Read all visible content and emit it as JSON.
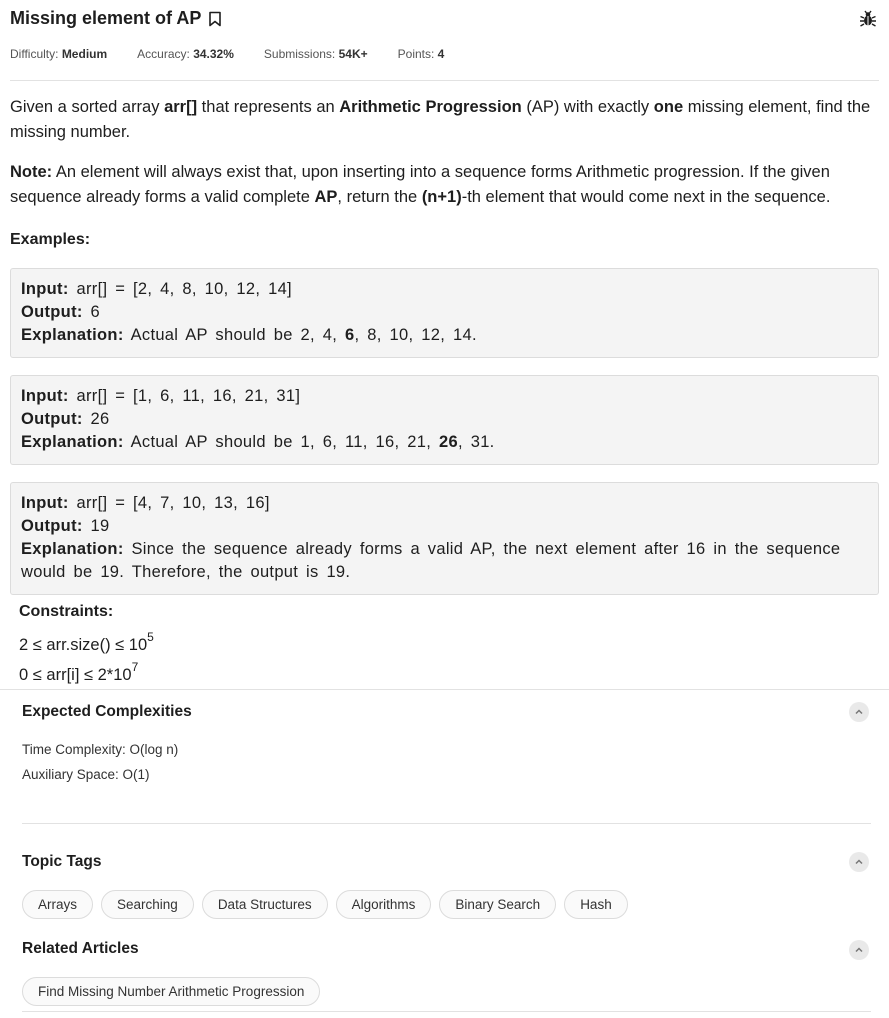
{
  "problem": {
    "title": "Missing element of AP",
    "meta": {
      "difficulty_label": "Difficulty:",
      "difficulty_value": "Medium",
      "accuracy_label": "Accuracy:",
      "accuracy_value": "34.32%",
      "submissions_label": "Submissions:",
      "submissions_value": "54K+",
      "points_label": "Points:",
      "points_value": "4"
    },
    "statement": {
      "p1": "Given a sorted array ",
      "arr": "arr[]",
      "p2": " that represents an ",
      "ap_bold": "Arithmetic Progression",
      "p3": " (AP) with exactly ",
      "one": "one",
      "p4": " missing element, find the missing number."
    },
    "note": {
      "label": "Note:",
      "t1": " An element will always exist that, upon inserting into a sequence forms Arithmetic progression. If the given sequence already forms a valid complete ",
      "ap": "AP",
      "t2": ", return the ",
      "n1": "(n+1)",
      "t3": "-th element that would come next in the sequence."
    },
    "examples_label": "Examples:",
    "examples": [
      {
        "input_label": "Input:",
        "input": " arr[] = [2, 4, 8, 10, 12, 14]",
        "output_label": "Output:",
        "output": " 6",
        "explanation_label": "Explanation:",
        "e1": " Actual AP should be 2, 4, ",
        "e_bold": "6",
        "e2": ", 8, 10, 12, 14."
      },
      {
        "input_label": "Input:",
        "input": " arr[] = [1, 6, 11, 16, 21, 31]",
        "output_label": "Output:",
        "output": " 26",
        "explanation_label": "Explanation:",
        "e1": " Actual AP should be 1, 6, 11, 16, 21, ",
        "e_bold": "26",
        "e2": ", 31."
      },
      {
        "input_label": "Input:",
        "input": " arr[] = [4, 7, 10, 13, 16]",
        "output_label": "Output:",
        "output": " 19",
        "explanation_label": "Explanation:",
        "e1": " Since the sequence already forms a valid AP, the next element after 16 in the sequence would be 19. Therefore, the output is 19.",
        "e_bold": "",
        "e2": ""
      }
    ],
    "constraints_label": "Constraints:",
    "constraints": [
      {
        "text": "2 ≤ arr.size() ≤ 10",
        "sup": "5"
      },
      {
        "text": "0 ≤ arr[i] ≤ 2*10",
        "sup": "7"
      }
    ]
  },
  "expected_complexities": {
    "title": "Expected Complexities",
    "time": "Time Complexity: O(log n)",
    "space": "Auxiliary Space: O(1)"
  },
  "topic_tags": {
    "title": "Topic Tags",
    "tags": [
      "Arrays",
      "Searching",
      "Data Structures",
      "Algorithms",
      "Binary Search",
      "Hash"
    ]
  },
  "related_articles": {
    "title": "Related Articles",
    "articles": [
      "Find Missing Number Arithmetic Progression"
    ]
  },
  "icons": {
    "bookmark": "bookmark-icon",
    "bug": "bug-icon",
    "chevron": "chevron-up-icon"
  }
}
